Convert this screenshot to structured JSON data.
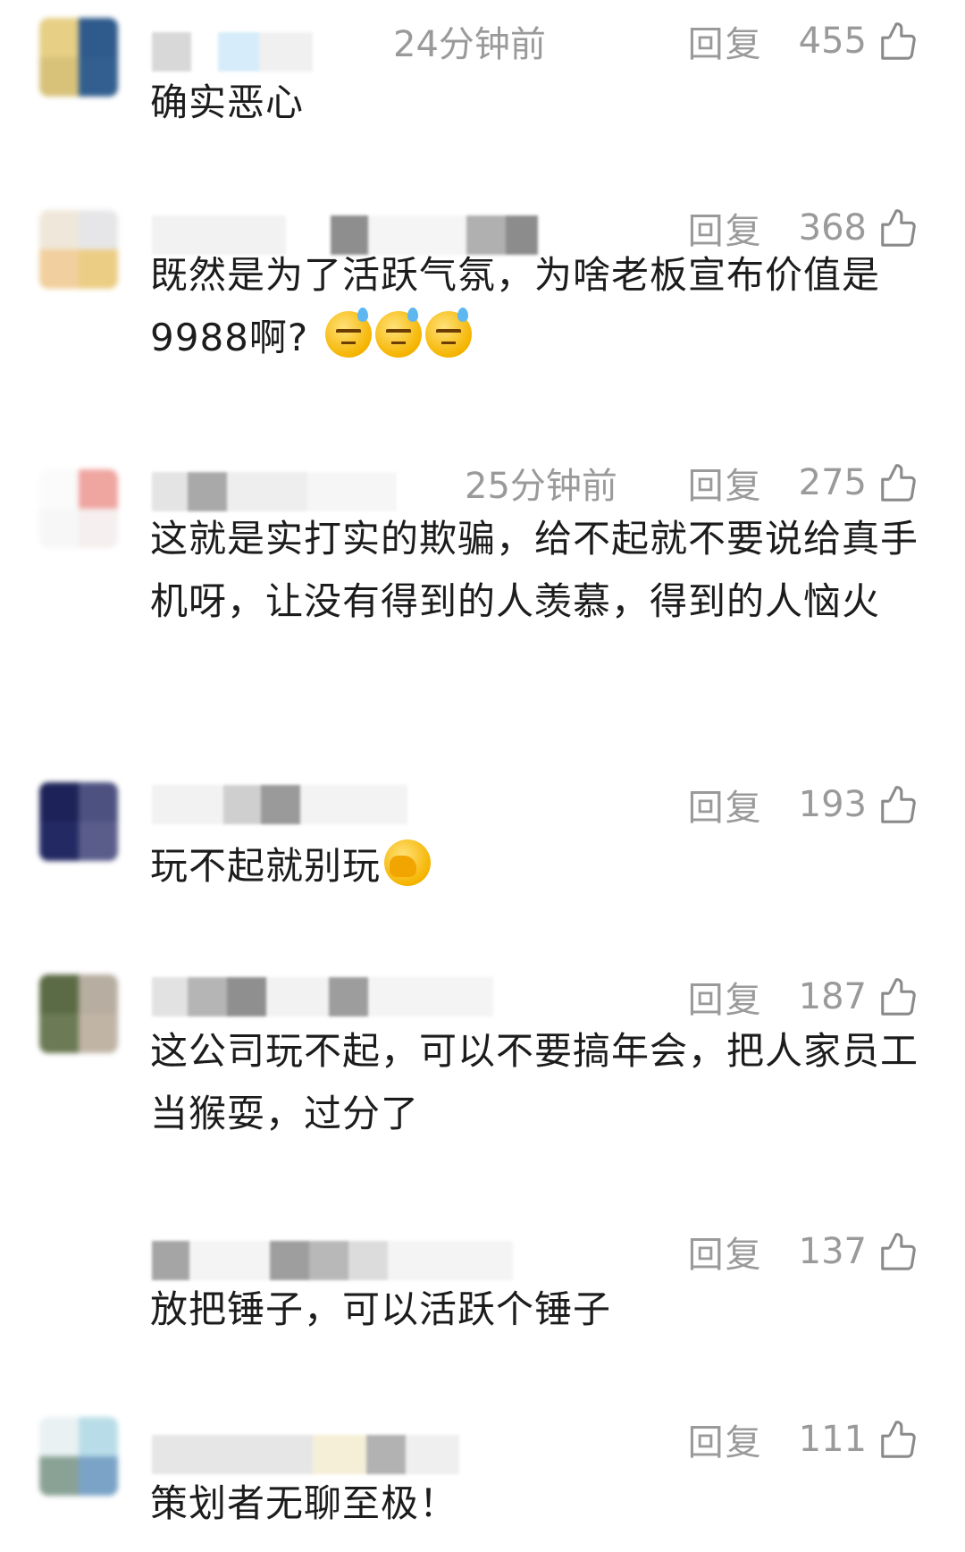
{
  "reply_label": "回复",
  "colors": {
    "meta_gray": "#9a9a9a",
    "text": "#1c1c1c"
  },
  "comments": [
    {
      "time": "24分钟前",
      "likes": "455",
      "text": "确实恶心"
    },
    {
      "time": "",
      "likes": "368",
      "text": "既然是为了活跃气氛，为啥老板宣布价值是9988啊?"
    },
    {
      "time": "25分钟前",
      "likes": "275",
      "text": "这就是实打实的欺骗，给不起就不要说给真手机呀，让没有得到的人羡慕，得到的人恼火"
    },
    {
      "time": "",
      "likes": "193",
      "text": "玩不起就别玩"
    },
    {
      "time": "",
      "likes": "187",
      "text": "这公司玩不起，可以不要搞年会，把人家员工当猴耍，过分了"
    },
    {
      "time": "",
      "likes": "137",
      "text": "放把锤子，可以活跃个锤子"
    },
    {
      "time": "",
      "likes": "111",
      "text": "策划者无聊至极！"
    }
  ],
  "icons": {
    "like": "thumbs-up-icon",
    "emoji_sweat": "sweat-smile-emoji-icon",
    "emoji_facepalm": "facepalm-emoji-icon"
  }
}
